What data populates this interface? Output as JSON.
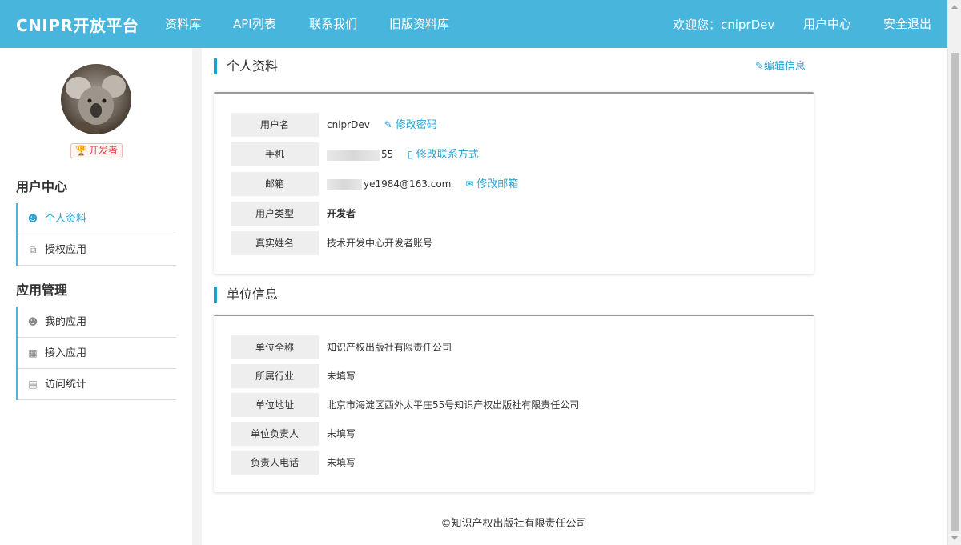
{
  "nav": {
    "brand": "CNIPR开放平台",
    "links": [
      "资料库",
      "API列表",
      "联系我们",
      "旧版资料库"
    ],
    "welcome": "欢迎您：cniprDev",
    "user_center": "用户中心",
    "logout": "安全退出"
  },
  "sidebar": {
    "role_badge": "开发者",
    "group1_title": "用户中心",
    "group1_items": [
      "个人资料",
      "授权应用"
    ],
    "group2_title": "应用管理",
    "group2_items": [
      "我的应用",
      "接入应用",
      "访问统计"
    ]
  },
  "profile": {
    "section_title": "个人资料",
    "edit_link": "编辑信息",
    "rows": [
      {
        "label": "用户名",
        "value": "cniprDev",
        "action": "修改密码"
      },
      {
        "label": "手机",
        "value": "55",
        "action": "修改联系方式"
      },
      {
        "label": "邮箱",
        "value": "ye1984@163.com",
        "action": "修改邮箱"
      },
      {
        "label": "用户类型",
        "value": "开发者"
      },
      {
        "label": "真实姓名",
        "value": "技术开发中心开发者账号"
      }
    ]
  },
  "org": {
    "section_title": "单位信息",
    "rows": [
      {
        "label": "单位全称",
        "value": "知识产权出版社有限责任公司"
      },
      {
        "label": "所属行业",
        "value": "未填写"
      },
      {
        "label": "单位地址",
        "value": "北京市海淀区西外太平庄55号知识产权出版社有限责任公司"
      },
      {
        "label": "单位负责人",
        "value": "未填写"
      },
      {
        "label": "负责人电话",
        "value": "未填写"
      }
    ]
  },
  "footer": "©知识产权出版社有限责任公司",
  "colors": {
    "nav_bg": "#48b5dc",
    "accent": "#2a9fd0",
    "badge": "#e0454a"
  }
}
